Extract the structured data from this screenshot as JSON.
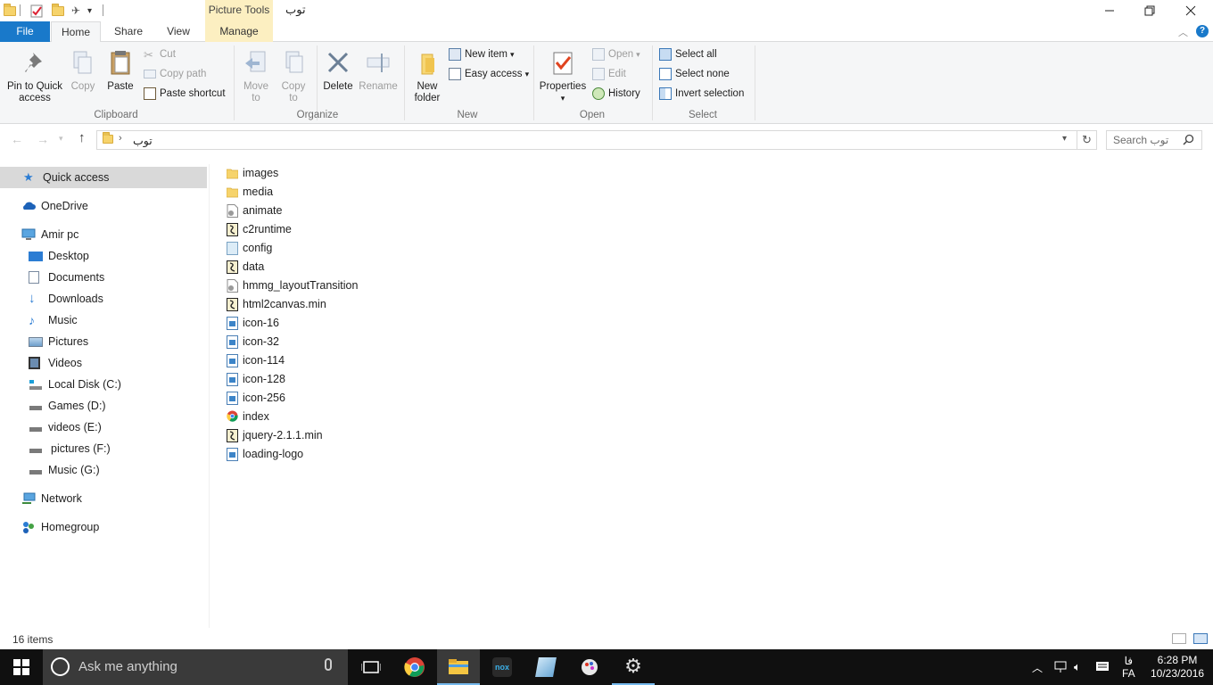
{
  "window": {
    "title": "توب",
    "contextual_tab_group": "Picture Tools"
  },
  "ribbon_tabs": [
    "File",
    "Home",
    "Share",
    "View",
    "Manage"
  ],
  "ribbon": {
    "clipboard": {
      "pin_label": "Pin to Quick",
      "pin_label2": "access",
      "copy_label": "Copy",
      "paste_label": "Paste",
      "cut_label": "Cut",
      "copy_path_label": "Copy path",
      "paste_shortcut_label": "Paste shortcut",
      "group_label": "Clipboard"
    },
    "organize": {
      "move_to_label": "Move",
      "move_to_label2": "to",
      "copy_to_label": "Copy",
      "copy_to_label2": "to",
      "delete_label": "Delete",
      "rename_label": "Rename",
      "group_label": "Organize"
    },
    "new": {
      "new_folder_label": "New",
      "new_folder_label2": "folder",
      "new_item_label": "New item",
      "easy_access_label": "Easy access",
      "group_label": "New"
    },
    "open": {
      "properties_label": "Properties",
      "open_label": "Open",
      "edit_label": "Edit",
      "history_label": "History",
      "group_label": "Open"
    },
    "select": {
      "select_all_label": "Select all",
      "select_none_label": "Select none",
      "invert_label": "Invert selection",
      "group_label": "Select"
    }
  },
  "address": {
    "path": "توب",
    "search_placeholder": "Search توب"
  },
  "nav": {
    "quick_access": "Quick access",
    "onedrive": "OneDrive",
    "this_pc": "Amir pc",
    "items": [
      "Desktop",
      "Documents",
      "Downloads",
      "Music",
      "Pictures",
      "Videos",
      "Local Disk (C:)",
      "Games (D:)",
      "videos (E:)",
      "pictures (F:)",
      "Music (G:)"
    ],
    "network": "Network",
    "homegroup": "Homegroup"
  },
  "files": [
    {
      "name": "images",
      "icon": "folder-icon"
    },
    {
      "name": "media",
      "icon": "folder-icon"
    },
    {
      "name": "animate",
      "icon": "settings-file-icon"
    },
    {
      "name": "c2runtime",
      "icon": "script-file-icon"
    },
    {
      "name": "config",
      "icon": "generic-file-icon"
    },
    {
      "name": "data",
      "icon": "script-file-icon"
    },
    {
      "name": "hmmg_layoutTransition",
      "icon": "settings-file-icon"
    },
    {
      "name": "html2canvas.min",
      "icon": "script-file-icon"
    },
    {
      "name": "icon-16",
      "icon": "image-file-icon"
    },
    {
      "name": "icon-32",
      "icon": "image-file-icon"
    },
    {
      "name": "icon-114",
      "icon": "image-file-icon"
    },
    {
      "name": "icon-128",
      "icon": "image-file-icon"
    },
    {
      "name": "icon-256",
      "icon": "image-file-icon"
    },
    {
      "name": "index",
      "icon": "chrome-html-icon"
    },
    {
      "name": "jquery-2.1.1.min",
      "icon": "script-file-icon"
    },
    {
      "name": "loading-logo",
      "icon": "image-file-icon"
    }
  ],
  "status": {
    "item_count": "16 items"
  },
  "taskbar": {
    "search_placeholder": "Ask me anything",
    "lang_top": "فا",
    "lang_bottom": "FA",
    "time": "6:28 PM",
    "date": "10/23/2016"
  },
  "colors": {
    "accent": "#1979ca",
    "contextual": "#fcefc1",
    "taskbar": "#101010",
    "selection": "#d9d9d9"
  }
}
